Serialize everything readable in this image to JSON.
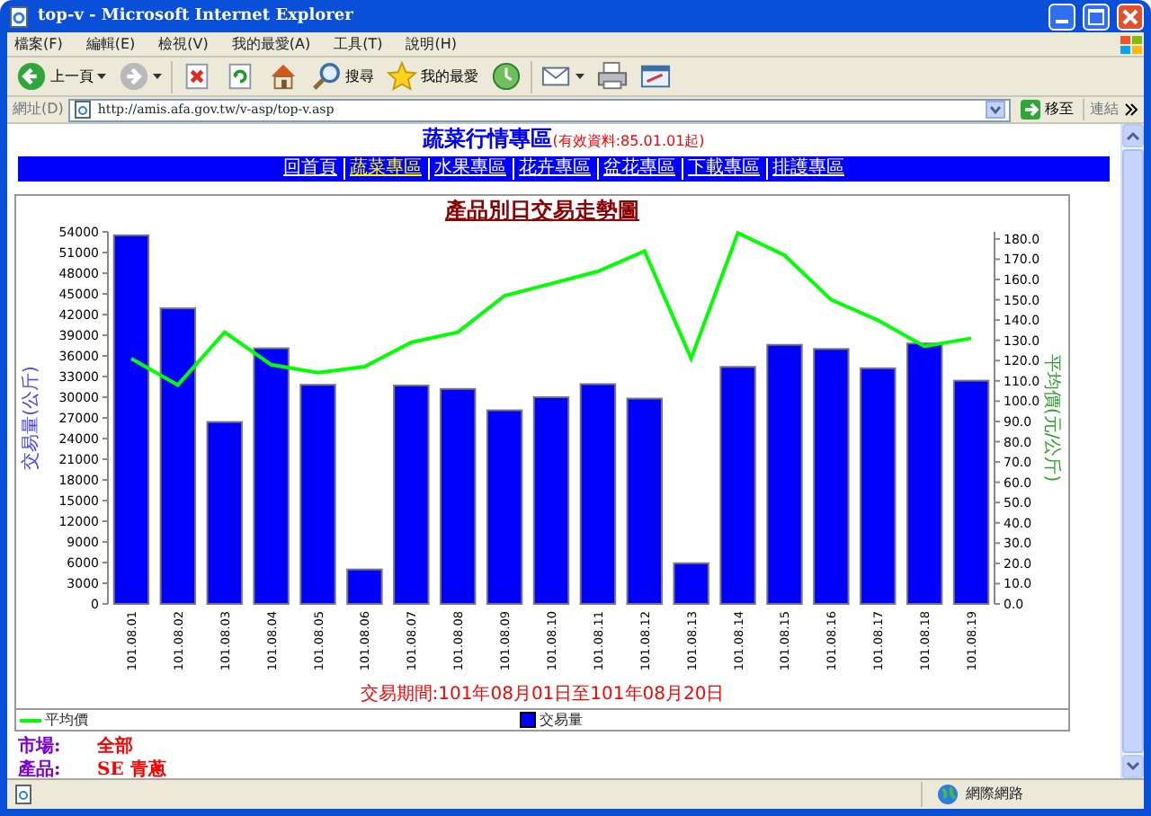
{
  "window": {
    "title": "top-v - Microsoft Internet Explorer"
  },
  "menu": [
    "檔案(F)",
    "編輯(E)",
    "檢視(V)",
    "我的最愛(A)",
    "工具(T)",
    "說明(H)"
  ],
  "toolbar": [
    {
      "kind": "back",
      "label": "上一頁"
    },
    {
      "kind": "forward"
    },
    {
      "kind": "stop"
    },
    {
      "kind": "refresh"
    },
    {
      "kind": "home"
    },
    {
      "kind": "search",
      "label": "搜尋"
    },
    {
      "kind": "favorites",
      "label": "我的最愛"
    },
    {
      "kind": "history"
    },
    {
      "kind": "mail"
    },
    {
      "kind": "print"
    },
    {
      "kind": "edit"
    }
  ],
  "address_bar": {
    "label": "網址(D)",
    "url": "http://amis.afa.gov.tw/v-asp/top-v.asp",
    "go": "移至",
    "links": "連結"
  },
  "page": {
    "heading": "蔬菜行情專區",
    "note": "(有效資料:85.01.01起)",
    "nav": [
      {
        "label": "回首頁",
        "selected": false
      },
      {
        "label": "蔬菜專區",
        "selected": true
      },
      {
        "label": "水果專區",
        "selected": false
      },
      {
        "label": "花卉專區",
        "selected": false
      },
      {
        "label": "盆花專區",
        "selected": false
      },
      {
        "label": "下載專區",
        "selected": false
      },
      {
        "label": "排護專區",
        "selected": false
      }
    ],
    "volume_chart": {
      "chart_data": {
        "type": "bar",
        "title": "產品別日交易走勢圖",
        "xlabel": "交易期間:101年08月01日至101年08月20日",
        "ylabel": "交易量(公斤)",
        "categories": [
          "101.08.01",
          "101.08.02",
          "101.08.03",
          "101.08.04",
          "101.08.05",
          "101.08.06",
          "101.08.07",
          "101.08.08",
          "101.08.09",
          "101.08.10",
          "101.08.11",
          "101.08.12",
          "101.08.13",
          "101.08.14",
          "101.08.15",
          "101.08.16",
          "101.08.17",
          "101.08.18",
          "101.08.19"
        ],
        "series": [
          {
            "name": "交易量",
            "color": "#0000ff",
            "values": [
              53500,
              42900,
              26400,
              37100,
              31800,
              5000,
              31700,
              31200,
              28100,
              30000,
              31900,
              29800,
              5900,
              34400,
              37600,
              37000,
              34200,
              37800,
              32400
            ]
          }
        ],
        "ylim": [
          0,
          54000
        ],
        "yticks": [
          0,
          3000,
          6000,
          9000,
          12000,
          15000,
          18000,
          21000,
          24000,
          27000,
          30000,
          33000,
          36000,
          39000,
          42000,
          45000,
          48000,
          51000,
          54000
        ]
      }
    },
    "price_chart": {
      "chart_data": {
        "type": "line",
        "ylabel": "平均價(元/公斤)",
        "categories": [
          null,
          null,
          null,
          null,
          null,
          null,
          null,
          null,
          null,
          null,
          null,
          null,
          null,
          null,
          null,
          null,
          null,
          null,
          null
        ],
        "series": [
          {
            "name": "平均價",
            "color": "#00ff00",
            "values": [
              121,
              108,
              134,
              118,
              114,
              117,
              129,
              134,
              152,
              158,
              164,
              174,
              121,
              183,
              172,
              150,
              140,
              127,
              131
            ]
          }
        ],
        "ylim": [
          0,
          183.5
        ],
        "yticks": [
          {
            "value": 0,
            "label": "0.0"
          },
          {
            "value": 10,
            "label": "10.0"
          },
          {
            "value": 20,
            "label": "20.0"
          },
          {
            "value": 30,
            "label": "30.0"
          },
          {
            "value": 40,
            "label": "40.0"
          },
          {
            "value": 50,
            "label": "50.0"
          },
          {
            "value": 60,
            "label": "60.0"
          },
          {
            "value": 70,
            "label": "70.0"
          },
          {
            "value": 80,
            "label": "80.0"
          },
          {
            "value": 90,
            "label": "90.0"
          },
          {
            "value": 100,
            "label": "100.0"
          },
          {
            "value": 110,
            "label": "110.0"
          },
          {
            "value": 120,
            "label": "120.0"
          },
          {
            "value": 130,
            "label": "130.0"
          },
          {
            "value": 140,
            "label": "140.0"
          },
          {
            "value": 150,
            "label": "150.0"
          },
          {
            "value": 160,
            "label": "160.0"
          },
          {
            "value": 170,
            "label": "170.0"
          },
          {
            "value": 180,
            "label": "180.0"
          }
        ]
      }
    },
    "info": [
      {
        "label": "市場:",
        "value": "全部"
      },
      {
        "label": "產品:",
        "value": "SE 青蔥"
      }
    ]
  },
  "status_bar": {
    "zone": "網際網路"
  }
}
